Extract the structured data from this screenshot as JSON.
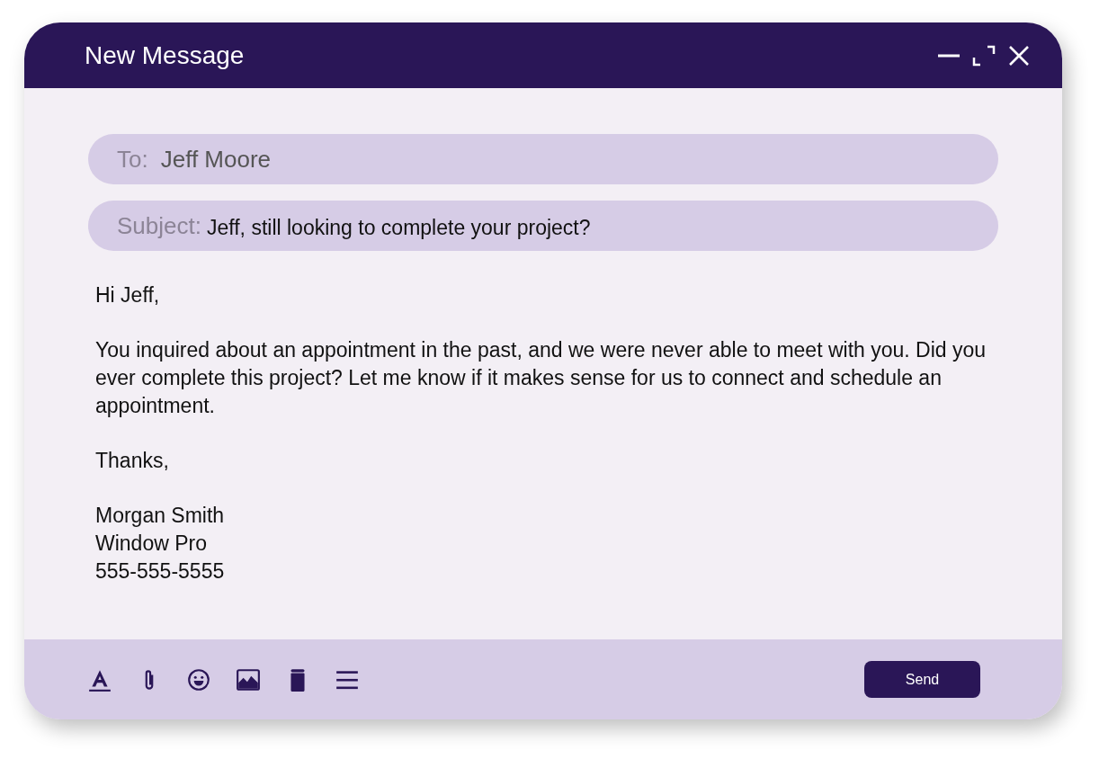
{
  "window": {
    "title": "New Message"
  },
  "fields": [
    {
      "label": "To:",
      "value": "Jeff Moore"
    },
    {
      "label": "Subject:",
      "value": "Jeff, still looking to complete your project?"
    }
  ],
  "body": {
    "paragraphs": [
      "Hi Jeff,",
      "You inquired about an appointment in the past, and we were never able to meet with you. Did you ever complete this project? Let me know if it makes sense for us to connect and schedule an appointment.",
      "Thanks,"
    ],
    "signature": [
      "Morgan Smith",
      "Window Pro",
      "555-555-5555"
    ]
  },
  "toolbar": [
    {
      "kind": "format"
    },
    {
      "kind": "attach"
    },
    {
      "kind": "emoji"
    },
    {
      "kind": "image"
    },
    {
      "kind": "trash"
    },
    {
      "kind": "menu"
    }
  ],
  "send_button": "Send"
}
